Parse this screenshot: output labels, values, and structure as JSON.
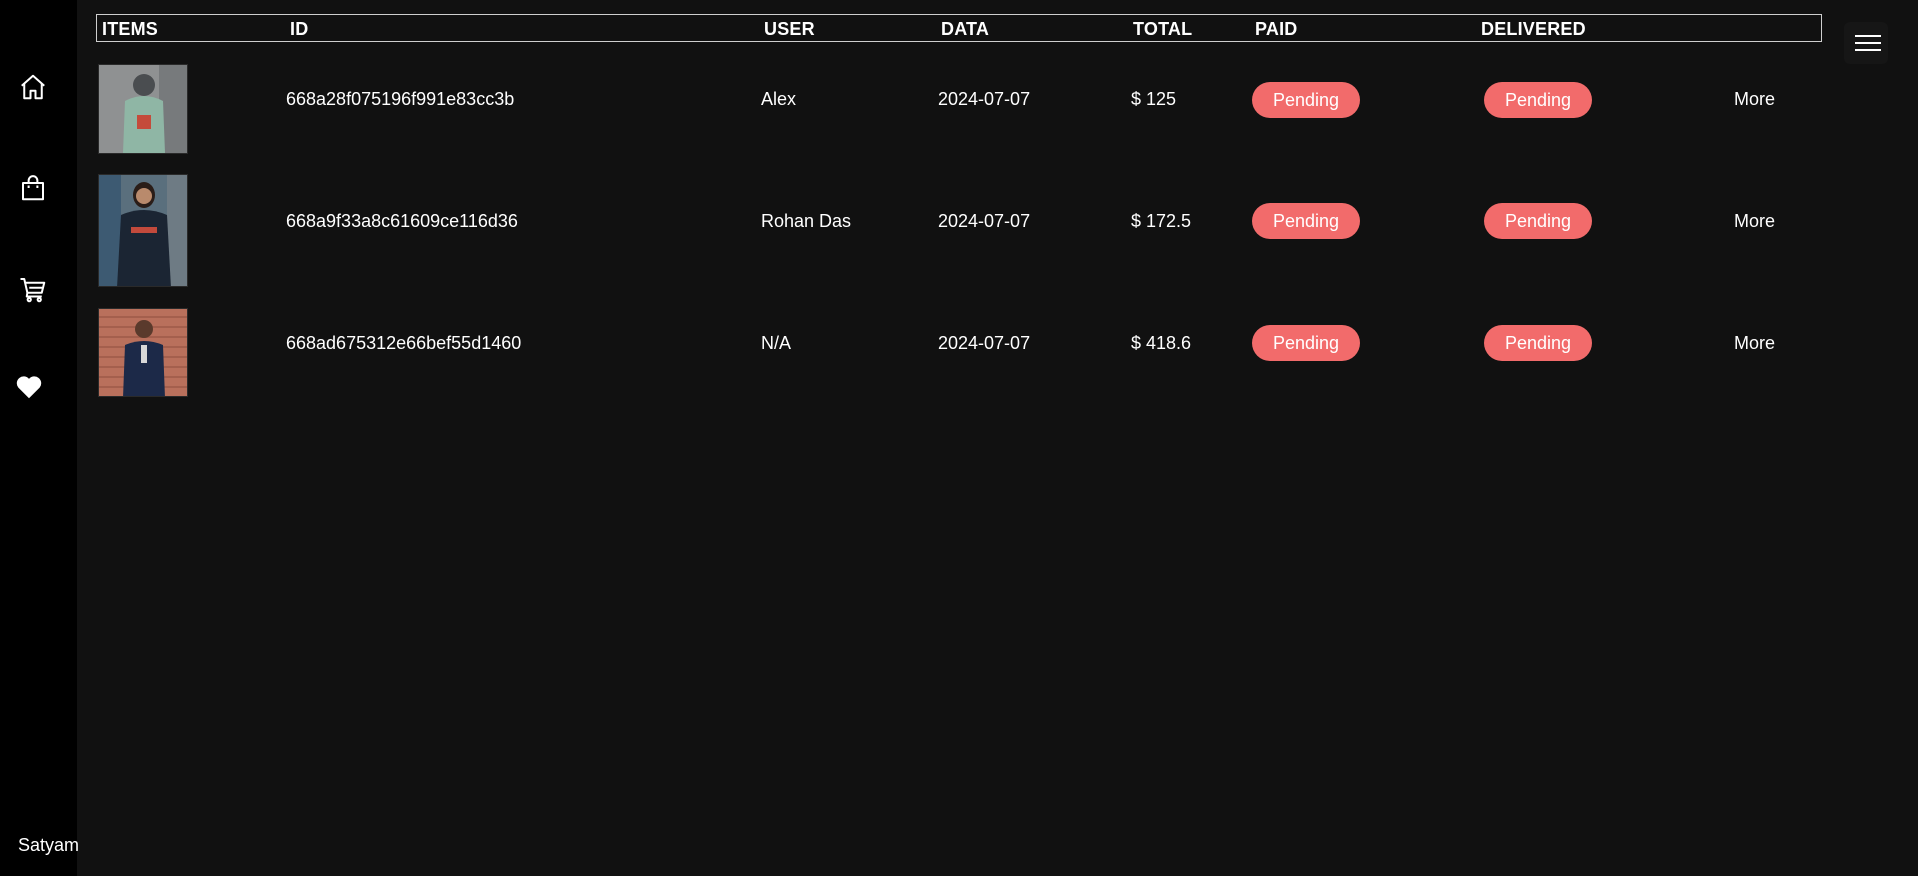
{
  "sidebar": {
    "icons": [
      "home-icon",
      "bag-icon",
      "cart-icon",
      "heart-icon"
    ],
    "user_name": "Satyam"
  },
  "table": {
    "headers": {
      "items": "ITEMS",
      "id": "ID",
      "user": "USER",
      "data": "DATA",
      "total": "TOTAL",
      "paid": "PAID",
      "delivered": "DELIVERED"
    },
    "rows": [
      {
        "id": "668a28f075196f991e83cc3b",
        "user": "Alex",
        "date": "2024-07-07",
        "total": "$ 125",
        "paid": "Pending",
        "delivered": "Pending",
        "more": "More"
      },
      {
        "id": "668a9f33a8c61609ce116d36",
        "user": "Rohan Das",
        "date": "2024-07-07",
        "total": "$ 172.5",
        "paid": "Pending",
        "delivered": "Pending",
        "more": "More"
      },
      {
        "id": "668ad675312e66bef55d1460",
        "user": "N/A",
        "date": "2024-07-07",
        "total": "$ 418.6",
        "paid": "Pending",
        "delivered": "Pending",
        "more": "More"
      }
    ]
  },
  "colors": {
    "background": "#111111",
    "sidebar": "#000000",
    "badge": "#f26b6b"
  }
}
